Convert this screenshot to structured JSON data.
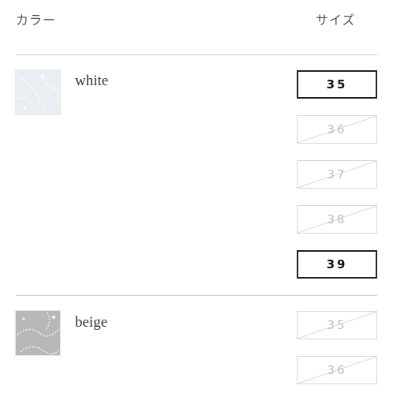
{
  "header": {
    "color_label": "カラー",
    "size_label": "サイズ"
  },
  "colors": [
    {
      "name": "white",
      "sizes": [
        {
          "label": "35",
          "available": true
        },
        {
          "label": "36",
          "available": false
        },
        {
          "label": "37",
          "available": false
        },
        {
          "label": "38",
          "available": false
        },
        {
          "label": "39",
          "available": true
        }
      ]
    },
    {
      "name": "beige",
      "sizes": [
        {
          "label": "35",
          "available": false
        },
        {
          "label": "36",
          "available": false
        }
      ]
    }
  ],
  "theme": {
    "available_border": "#222222",
    "unavailable_border": "#d6d6d6",
    "unavailable_text": "#bdbdbd",
    "divider": "#cfcfcf"
  }
}
